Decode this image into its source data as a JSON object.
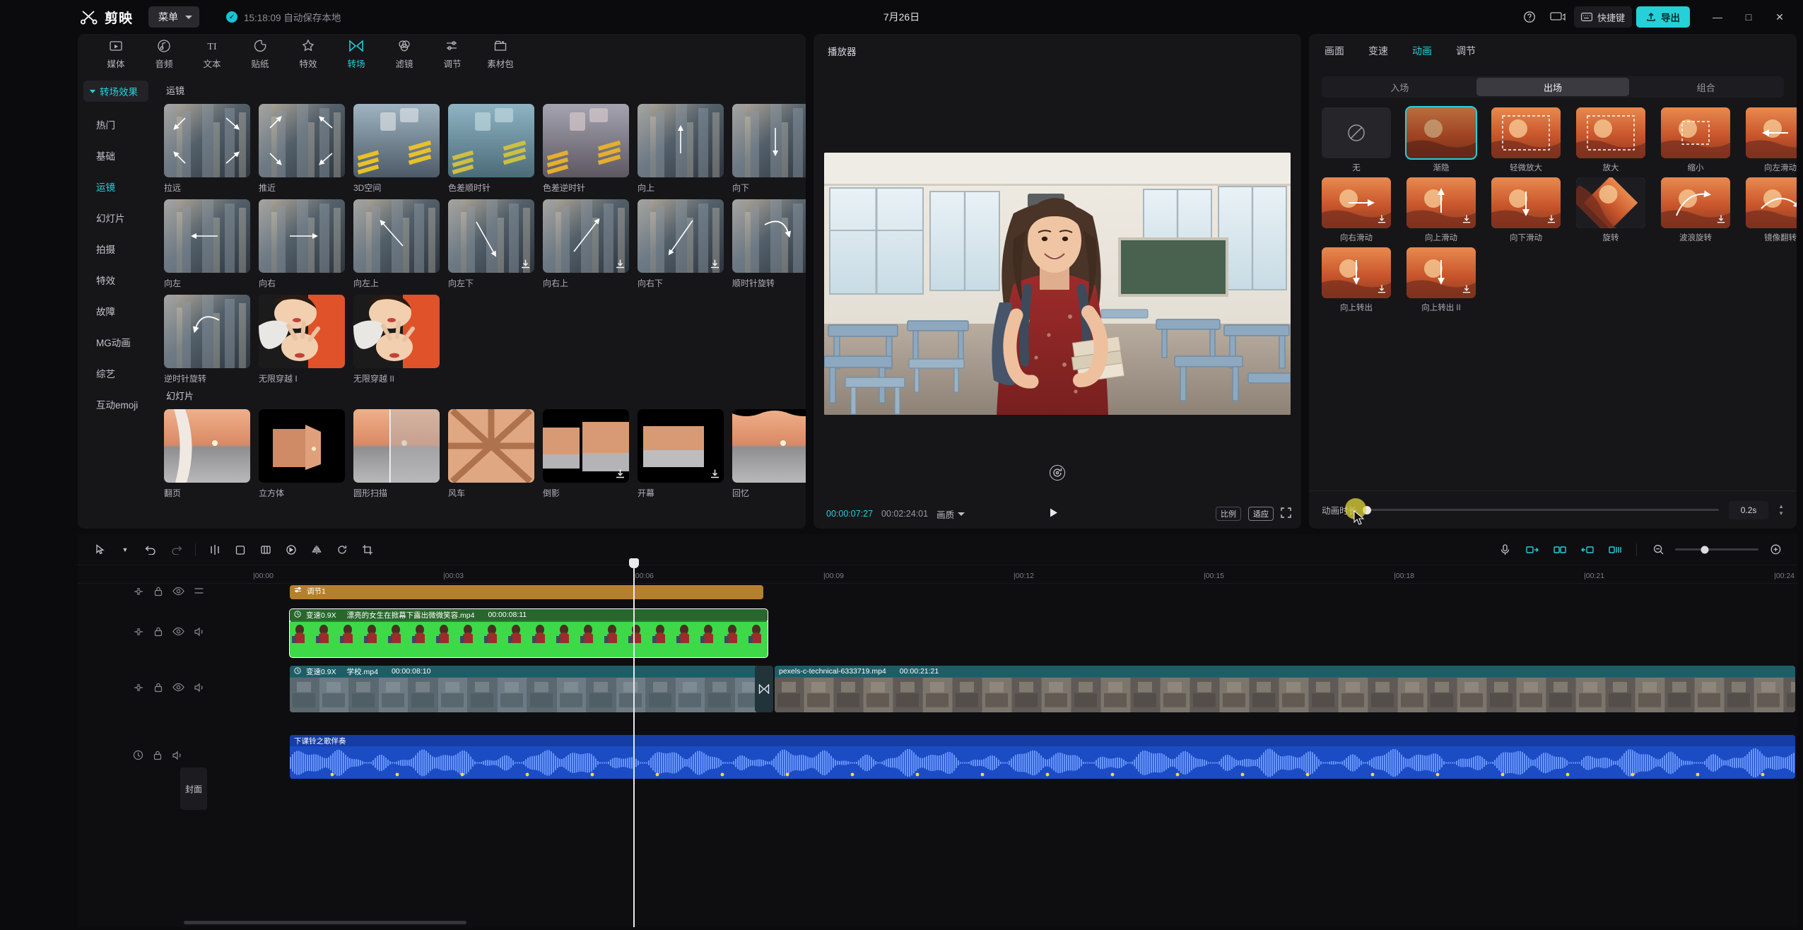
{
  "titlebar": {
    "app_name": "剪映",
    "menu_label": "菜单",
    "autosave_text": "15:18:09 自动保存本地",
    "project_date": "7月26日",
    "shortcut_label": "快捷键",
    "export_label": "导出",
    "help_icon": "help-icon",
    "display_icon": "monitor-icon",
    "minimize": "—",
    "maximize": "□",
    "close": "✕"
  },
  "left_panel": {
    "tabs": [
      {
        "label": "媒体",
        "icon": "media-icon",
        "active": false
      },
      {
        "label": "音频",
        "icon": "audio-icon",
        "active": false
      },
      {
        "label": "文本",
        "icon": "text-icon",
        "active": false
      },
      {
        "label": "贴纸",
        "icon": "sticker-icon",
        "active": false
      },
      {
        "label": "特效",
        "icon": "effects-icon",
        "active": false
      },
      {
        "label": "转场",
        "icon": "transition-icon",
        "active": true
      },
      {
        "label": "滤镜",
        "icon": "filter-icon",
        "active": false
      },
      {
        "label": "调节",
        "icon": "adjust-icon",
        "active": false
      },
      {
        "label": "素材包",
        "icon": "material-pack-icon",
        "active": false
      }
    ],
    "category_header": "转场效果",
    "categories": [
      {
        "label": "热门",
        "active": false
      },
      {
        "label": "基础",
        "active": false
      },
      {
        "label": "运镜",
        "active": true
      },
      {
        "label": "幻灯片",
        "active": false
      },
      {
        "label": "拍摄",
        "active": false
      },
      {
        "label": "特效",
        "active": false
      },
      {
        "label": "故障",
        "active": false
      },
      {
        "label": "MG动画",
        "active": false
      },
      {
        "label": "综艺",
        "active": false
      },
      {
        "label": "互动emoji",
        "active": false
      }
    ],
    "sections": [
      {
        "title": "运镜",
        "items": [
          {
            "label": "拉远",
            "style": "zoomout",
            "download": false
          },
          {
            "label": "推近",
            "style": "zoomin",
            "download": false
          },
          {
            "label": "3D空间",
            "style": "space3d",
            "download": false
          },
          {
            "label": "色差顺时针",
            "style": "chromacw",
            "download": false
          },
          {
            "label": "色差逆时针",
            "style": "chromaccw",
            "download": false
          },
          {
            "label": "向上",
            "style": "up",
            "download": false
          },
          {
            "label": "向下",
            "style": "down",
            "download": false
          },
          {
            "label": "向左",
            "style": "left",
            "download": false
          },
          {
            "label": "向右",
            "style": "right",
            "download": false
          },
          {
            "label": "向左上",
            "style": "upleft",
            "download": false
          },
          {
            "label": "向左下",
            "style": "downleft",
            "download": true
          },
          {
            "label": "向右上",
            "style": "upright",
            "download": true
          },
          {
            "label": "向右下",
            "style": "downright",
            "download": true
          },
          {
            "label": "顺时针旋转",
            "style": "rotcw",
            "download": false
          },
          {
            "label": "逆时针旋转",
            "style": "rotccw",
            "download": false
          },
          {
            "label": "无限穿越 I",
            "style": "infinite1",
            "download": false
          },
          {
            "label": "无限穿越 II",
            "style": "infinite2",
            "download": false
          }
        ]
      },
      {
        "title": "幻灯片",
        "items": [
          {
            "label": "翻页",
            "style": "pageflip",
            "download": false
          },
          {
            "label": "立方体",
            "style": "cube",
            "download": false
          },
          {
            "label": "圆形扫描",
            "style": "circlescan",
            "download": false
          },
          {
            "label": "风车",
            "style": "windmill",
            "download": false
          },
          {
            "label": "倒影",
            "style": "reflect",
            "download": true
          },
          {
            "label": "开幕",
            "style": "curtain",
            "download": true
          },
          {
            "label": "回忆",
            "style": "memory",
            "download": true
          }
        ]
      }
    ]
  },
  "player": {
    "title": "播放器",
    "current_time": "00:00:07:27",
    "total_time": "00:02:24:01",
    "quality_label": "画质",
    "play_icon": "play-icon",
    "rotate_icon": "rotate-icon",
    "chip_left": "比例",
    "chip_right": "适应",
    "fullscreen_icon": "fullscreen-icon"
  },
  "right_panel": {
    "tabs": [
      {
        "label": "画面",
        "active": false
      },
      {
        "label": "变速",
        "active": false
      },
      {
        "label": "动画",
        "active": true
      },
      {
        "label": "调节",
        "active": false
      }
    ],
    "segments": [
      {
        "label": "入场",
        "active": false
      },
      {
        "label": "出场",
        "active": true
      },
      {
        "label": "组合",
        "active": false
      }
    ],
    "animations": [
      {
        "label": "无",
        "kind": "none",
        "selected": false,
        "download": false
      },
      {
        "label": "渐隐",
        "kind": "fade",
        "selected": true,
        "download": false
      },
      {
        "label": "轻微放大",
        "kind": "zoomslight",
        "selected": false,
        "download": false
      },
      {
        "label": "放大",
        "kind": "zoomin",
        "selected": false,
        "download": false
      },
      {
        "label": "缩小",
        "kind": "zoomout",
        "selected": false,
        "download": false
      },
      {
        "label": "向左滑动",
        "kind": "slideleft",
        "selected": false,
        "download": false
      },
      {
        "label": "向右滑动",
        "kind": "slideright",
        "selected": false,
        "download": true
      },
      {
        "label": "向上滑动",
        "kind": "slideup",
        "selected": false,
        "download": true
      },
      {
        "label": "向下滑动",
        "kind": "slidedown",
        "selected": false,
        "download": true
      },
      {
        "label": "旋转",
        "kind": "rotate",
        "selected": false,
        "download": false
      },
      {
        "label": "波浪旋转",
        "kind": "waverotate",
        "selected": false,
        "download": true
      },
      {
        "label": "镜像翻转",
        "kind": "mirrorflip",
        "selected": false,
        "download": true
      },
      {
        "label": "向上转出",
        "kind": "rollup1",
        "selected": false,
        "download": true
      },
      {
        "label": "向上转出 II",
        "kind": "rollup2",
        "selected": false,
        "download": true
      }
    ],
    "duration_label": "动画时长",
    "duration_value": "0.2s"
  },
  "timeline": {
    "toolbar": {
      "select_icon": "cursor-select-icon",
      "undo_icon": "undo-icon",
      "redo_icon": "redo-icon",
      "split_icon": "split-icon",
      "delete_icon": "delete-icon",
      "freeze_icon": "freeze-frame-icon",
      "reverse_icon": "reverse-icon",
      "mirror_icon": "mirror-icon",
      "rotate_icon": "rotate-icon",
      "crop_icon": "crop-icon",
      "mic_icon": "microphone-icon",
      "keyframe1_icon": "keyframe-prev-icon",
      "keyframe2_icon": "keyframe-add-icon",
      "keyframe3_icon": "keyframe-next-icon",
      "keyframe4_icon": "keyframe-mix-icon",
      "zoom_out_icon": "zoom-out-icon",
      "zoom_in_icon": "zoom-in-icon"
    },
    "ruler_ticks": [
      "|00:00",
      "|00:03",
      "|00:06",
      "|00:09",
      "|00:12",
      "|00:15",
      "|00:18",
      "|00:21",
      "|00:24"
    ],
    "cover_label": "封面",
    "tracks": [
      {
        "type": "adjust",
        "clips": [
          {
            "label": "调节1",
            "icon": "adjust-icon"
          }
        ]
      },
      {
        "type": "video_overlay",
        "clips": [
          {
            "speed": "变速0.9X",
            "name": "漂亮的女生在掀幕下露出微微笑容.mp4",
            "duration": "00:00:08:11"
          }
        ]
      },
      {
        "type": "video_main",
        "clips": [
          {
            "speed": "变速0.9X",
            "name": "学校.mp4",
            "duration": "00:00:08:10"
          },
          {
            "name": "pexels-c-technical-6333719.mp4",
            "duration": "00:00:21:21"
          }
        ]
      },
      {
        "type": "audio",
        "clips": [
          {
            "name": "下课铃之歌伴奏"
          }
        ]
      }
    ]
  }
}
